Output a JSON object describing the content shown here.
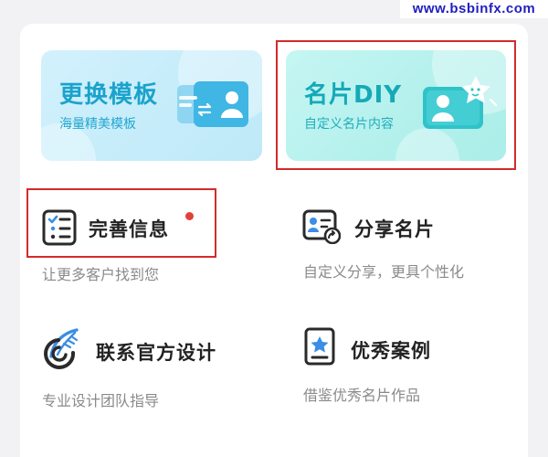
{
  "watermark": {
    "text": "www.bsbinfx.com"
  },
  "cards": {
    "template": {
      "title": "更换模板",
      "subtitle": "海量精美模板"
    },
    "diy": {
      "title": "名片DIY",
      "subtitle": "自定义名片内容"
    }
  },
  "features": [
    {
      "title": "完善信息",
      "desc": "让更多客户找到您",
      "icon": "checklist-icon",
      "badge": true
    },
    {
      "title": "分享名片",
      "desc": "自定义分享，更具个性化",
      "icon": "share-card-icon",
      "badge": false
    },
    {
      "title": "联系官方设计",
      "desc": "专业设计团队指导",
      "icon": "feather-design-icon",
      "badge": false
    },
    {
      "title": "优秀案例",
      "desc": "借鉴优秀名片作品",
      "icon": "star-card-icon",
      "badge": false
    }
  ],
  "colors": {
    "highlight": "#d52a2a",
    "template_title": "#1aa3cc",
    "diy_title": "#15a9b8",
    "badge": "#e2413a"
  }
}
